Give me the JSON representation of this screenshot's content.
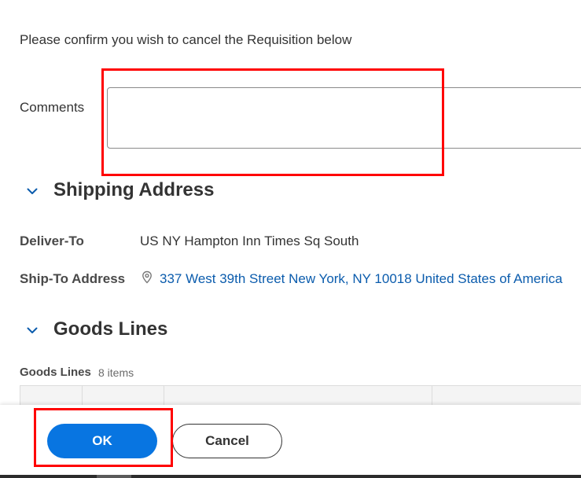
{
  "dialog": {
    "prompt": "Please confirm you wish to cancel the Requisition below"
  },
  "comments": {
    "label": "Comments",
    "value": "",
    "placeholder": ""
  },
  "shipping_address": {
    "title": "Shipping Address",
    "deliver_to_label": "Deliver-To",
    "deliver_to_value": "US NY Hampton Inn Times Sq South",
    "ship_to_label": "Ship-To Address",
    "ship_to_value": "337 West 39th Street New York, NY 10018 United States of America"
  },
  "goods_lines": {
    "title": "Goods Lines",
    "table_label": "Goods Lines",
    "count": "8 items"
  },
  "footer": {
    "ok_label": "OK",
    "cancel_label": "Cancel"
  },
  "colors": {
    "primary": "#0875e1",
    "link": "#0b5cad",
    "annotation_red": "#ff0000"
  },
  "icons": {
    "section_toggle": "chevron-down-icon",
    "address": "location-pin-icon"
  }
}
